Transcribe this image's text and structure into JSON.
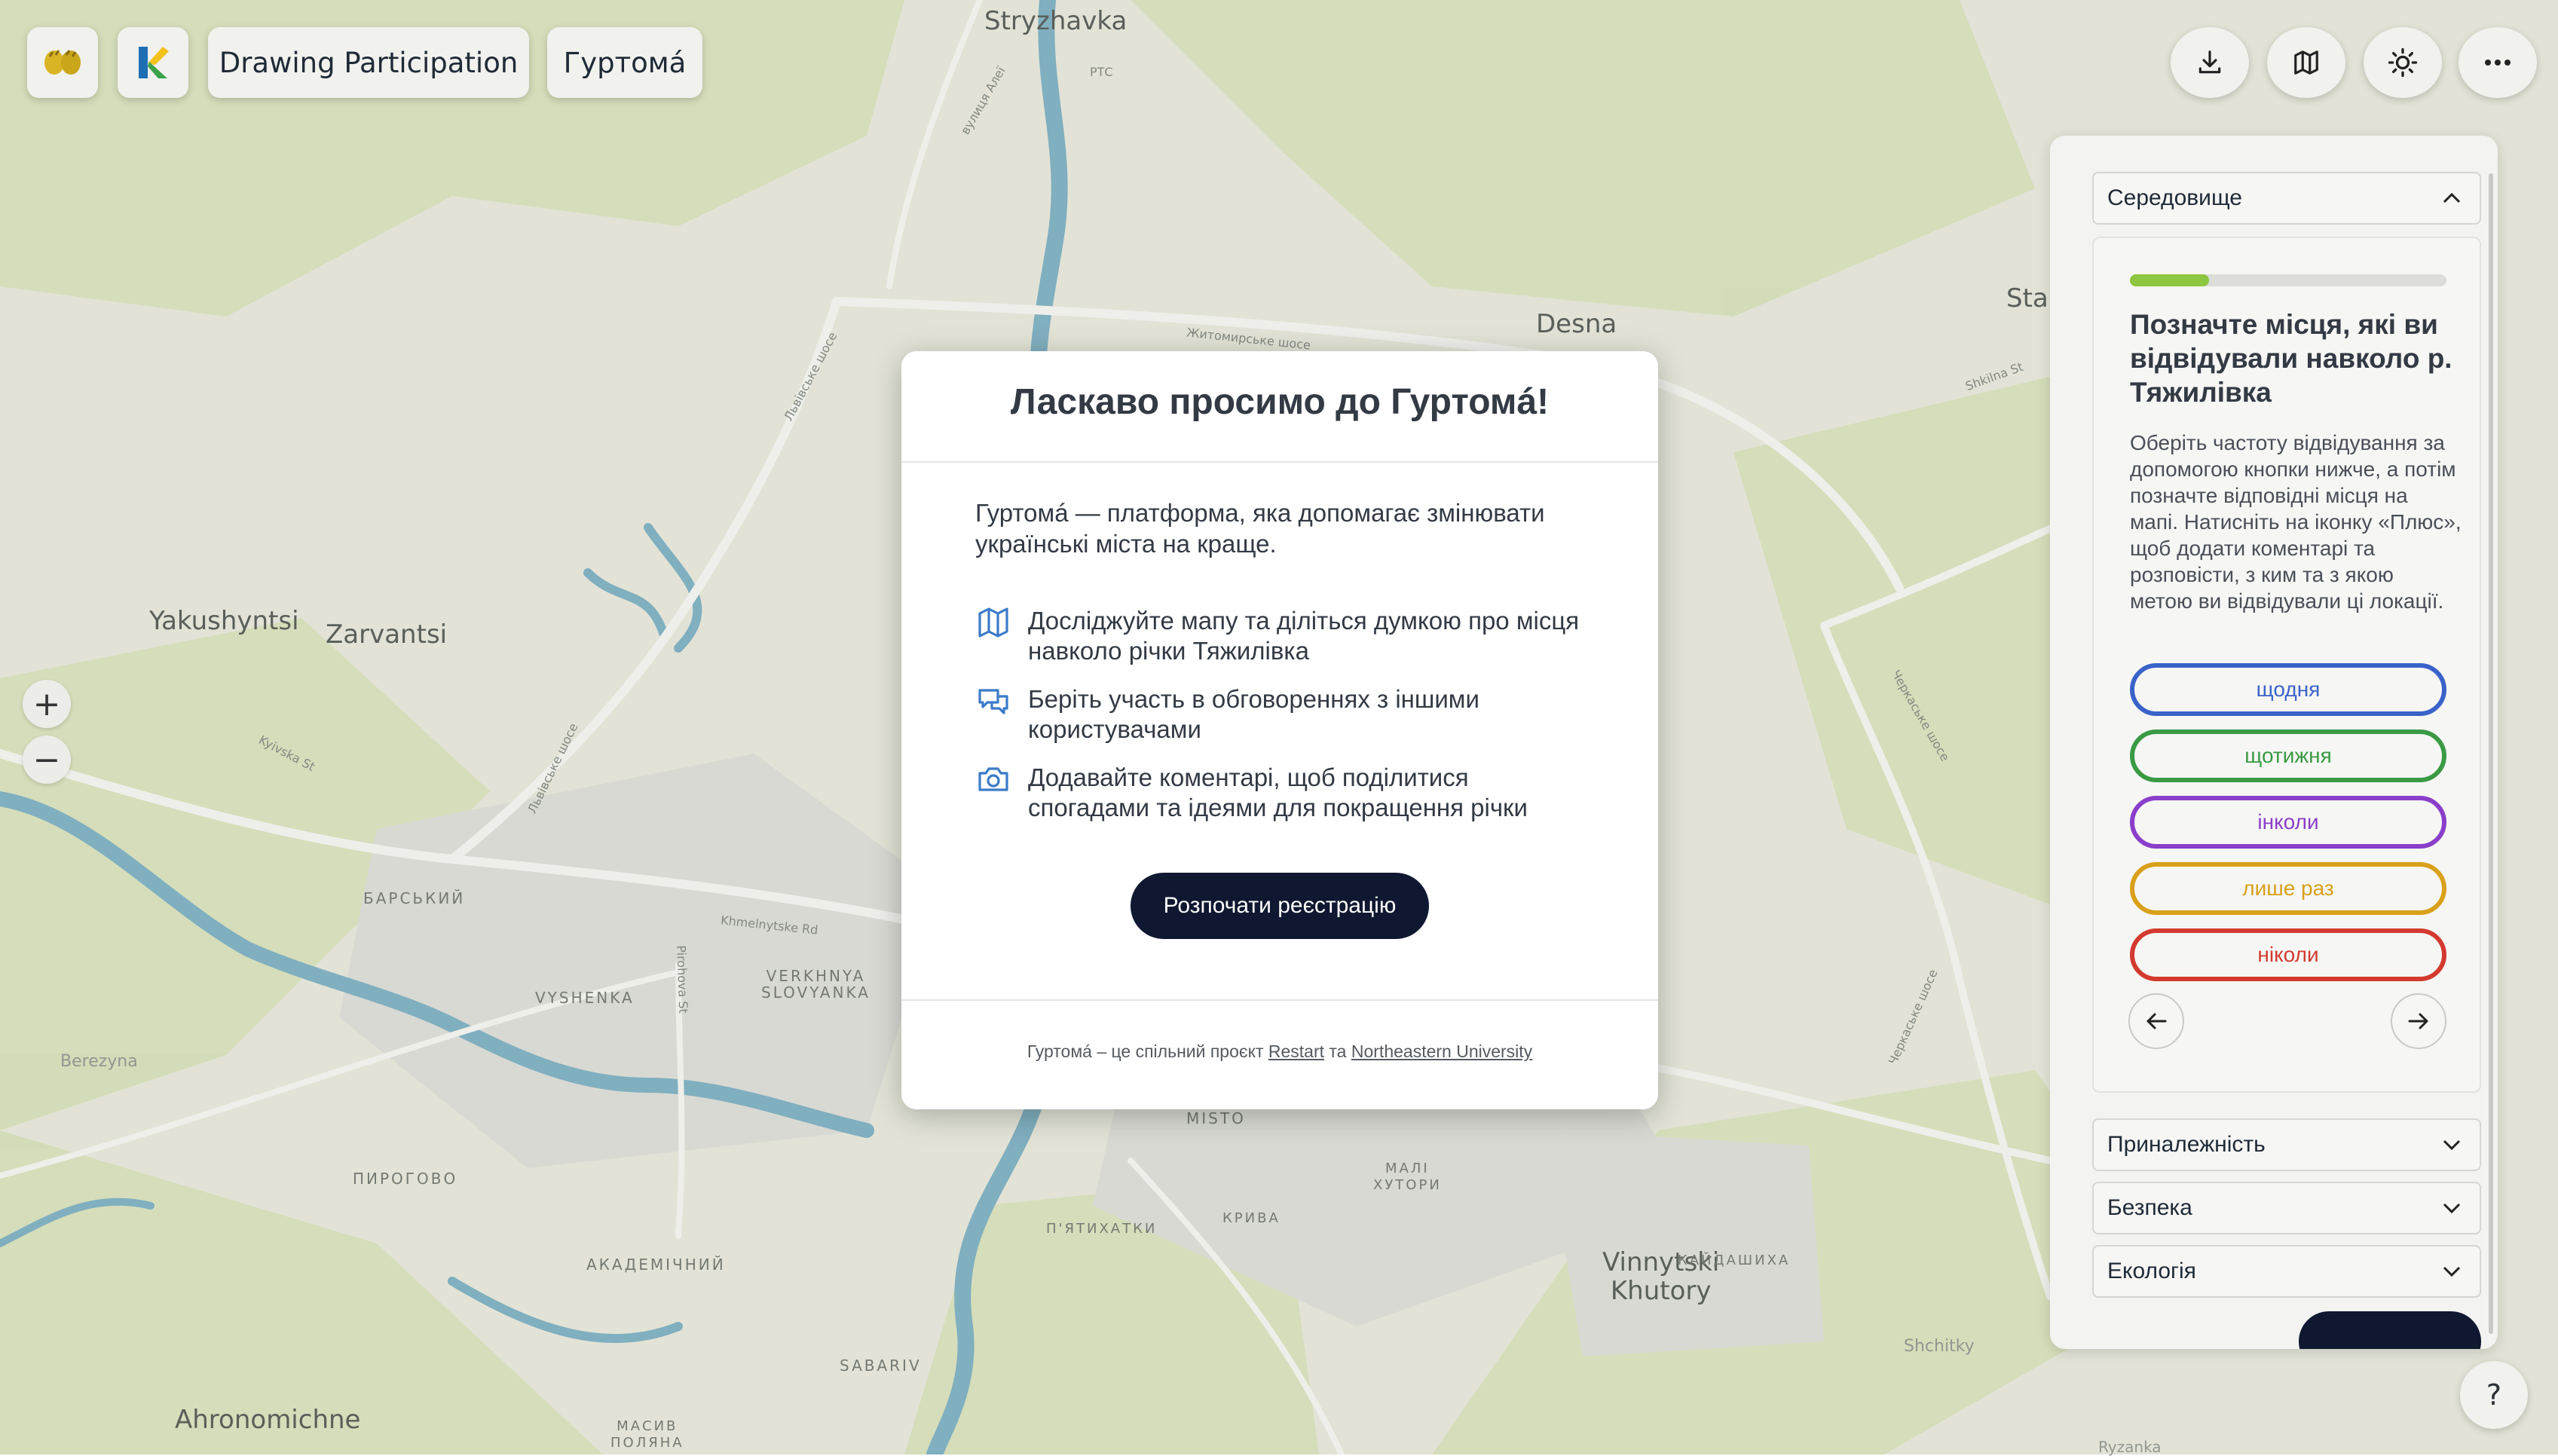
{
  "toolbar": {
    "logo_icon": "hands-logo-icon",
    "brand_icon": "restart-k-logo-icon",
    "project_label": "Drawing Participation",
    "app_label": "Гуртомá",
    "download_icon": "download-icon",
    "map_icon": "map-icon",
    "theme_icon": "sun-icon",
    "more_icon": "more-icon"
  },
  "map": {
    "labels": {
      "stryzhavka": "Stryzhavka",
      "desna": "Desna",
      "yakushyntsi": "Yakushyntsi",
      "zarvantsi": "Zarvantsi",
      "berezyna": "Berezyna",
      "ahronomichne": "Ahronomichne",
      "vinnytski_khutory": "Vinnytski\nKhutory",
      "shchitky": "Shchitky",
      "barskyi": "БАРСЬКИЙ",
      "vyshenka": "VYSHENKA",
      "verkhnya": "VERKHNYA\nSLOVYANKA",
      "pyrohovo": "ПИРОГОВО",
      "akademichnyi": "АКАДЕМІЧНИЙ",
      "sabariv": "SABARIV",
      "misto": "MISTO",
      "kryva": "КРИВА",
      "pyatykhatky": "П'ЯТИХАТКИ",
      "mali_khutory": "МАЛІ\nХУТОРИ",
      "kaidashikha": "КАЙДАШИХА",
      "masyv": "МАСИВ\nПОЛЯНА",
      "stadium_partial": "Sta",
      "ryzanka": "Ryzanka",
      "zhytomyrske": "Житомирське шосе",
      "lvivske": "Львівське шосе",
      "lvivske2": "Львівське шосе",
      "cherkaske": "Черкаське шосе",
      "cherkaske2": "Черкаське шосе",
      "khmelnytske": "Khmelnytske Rd",
      "pirohova": "Pirohova St",
      "kyivska": "Kyivska St",
      "shkilna": "Shkilna St",
      "vulytsia_alei": "вулиця Алеї",
      "ptc": "РТС"
    },
    "zoom_in": "+",
    "zoom_out": "−"
  },
  "panel": {
    "section_open": "Середовище",
    "progress_fraction": 0.25,
    "card_title": "Позначте місця, які ви відвідували навколо р. Тяжилівка",
    "card_body": "Оберіть частоту відвідування за допомогою кнопки нижче, а потім позначте відповідні місця на мапі. Натисніть на іконку «Плюс», щоб додати коментарі та розповісти, з ким та з якою метою ви відвідували ці локації.",
    "options": [
      {
        "label": "щодня",
        "color": "#3a63c9"
      },
      {
        "label": "щотижня",
        "color": "#3a9a43"
      },
      {
        "label": "інколи",
        "color": "#8a3ec9"
      },
      {
        "label": "лише раз",
        "color": "#d9a01a"
      },
      {
        "label": "ніколи",
        "color": "#d33a2f"
      }
    ],
    "sections": [
      "Приналежність",
      "Безпека",
      "Екологія"
    ]
  },
  "modal": {
    "title": "Ласкаво просимо до Гуртомá!",
    "intro": "Гуртомá — платформа, яка допомагає змінювати українські міста на краще.",
    "features": [
      {
        "icon": "map-icon",
        "text": "Досліджуйте мапу та діліться думкою про місця навколо річки Тяжилівка"
      },
      {
        "icon": "chat-icon",
        "text": "Беріть участь в обговореннях з іншими користувачами"
      },
      {
        "icon": "camera-icon",
        "text": "Додавайте коментарі, щоб поділитися спогадами та ідеями для покращення річки"
      }
    ],
    "start_button": "Розпочати реєстрацію",
    "footer_prefix": "Гуртомá – це спільний проєкт ",
    "footer_link1": "Restart",
    "footer_mid": " та ",
    "footer_link2": "Northeastern University"
  },
  "help_label": "?",
  "colors": {
    "map_bg": "#f0efe3",
    "park": "#dfe8c4",
    "water": "#7fb4c9",
    "button_dark": "#0f1830",
    "progress": "#8dc63f"
  }
}
